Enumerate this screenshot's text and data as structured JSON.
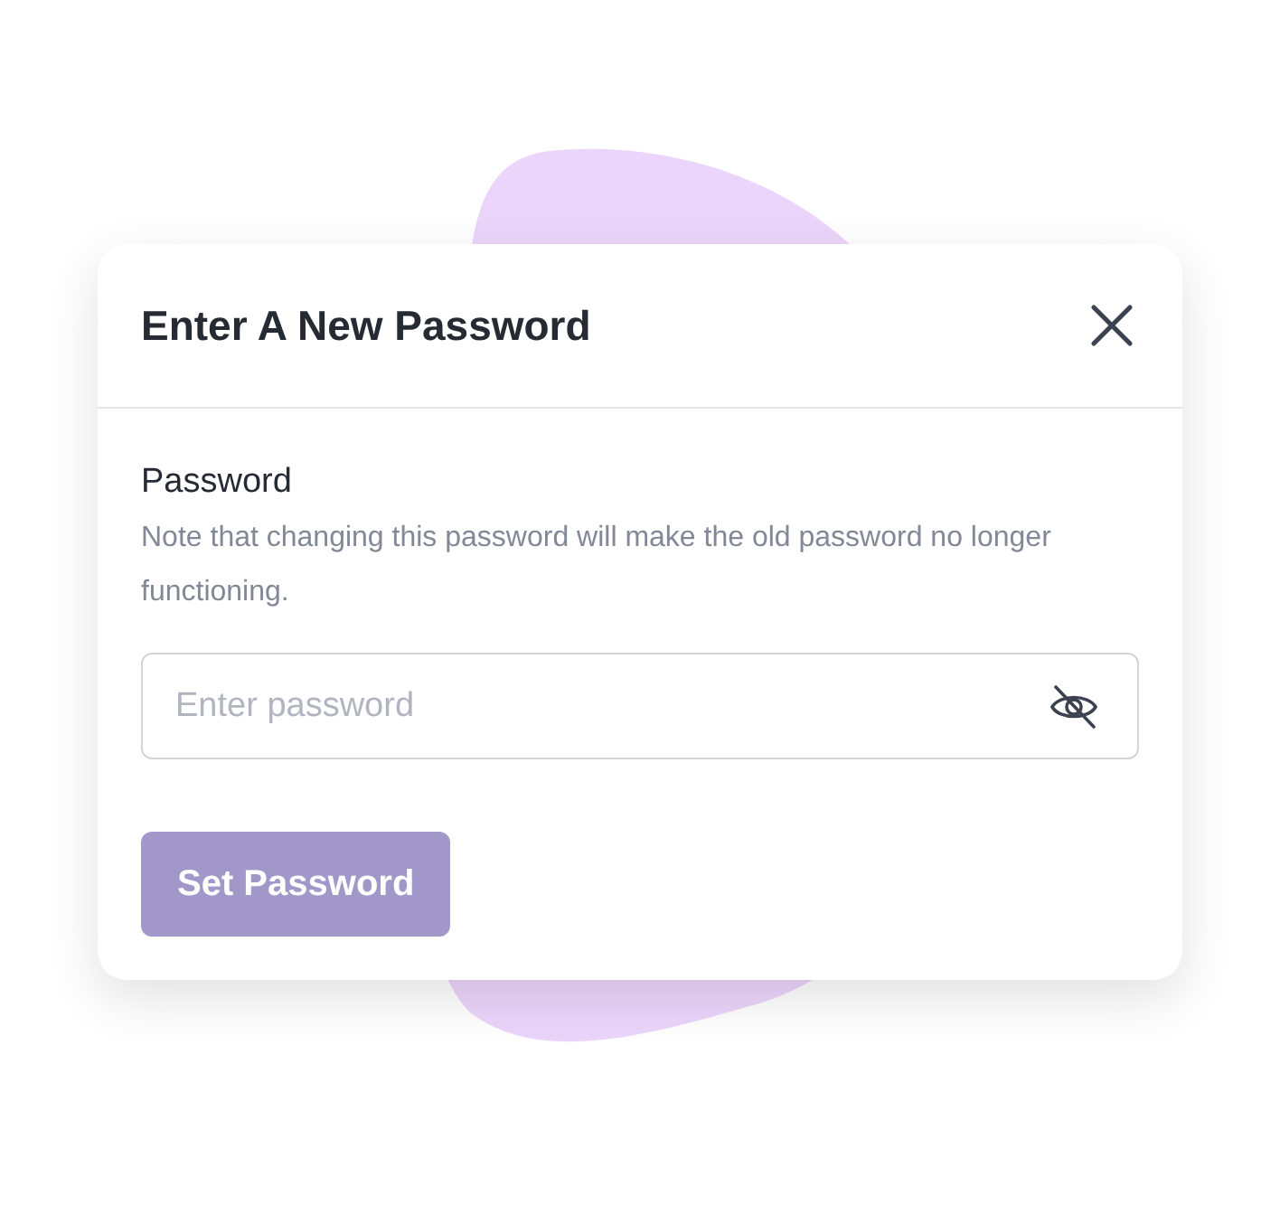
{
  "dialog": {
    "title": "Enter A New Password",
    "field": {
      "label": "Password",
      "note": "Note that changing this password will make the old password no longer functioning.",
      "placeholder": "Enter password",
      "visible": false
    },
    "submit": {
      "label": "Set Password",
      "disabled": true
    }
  }
}
